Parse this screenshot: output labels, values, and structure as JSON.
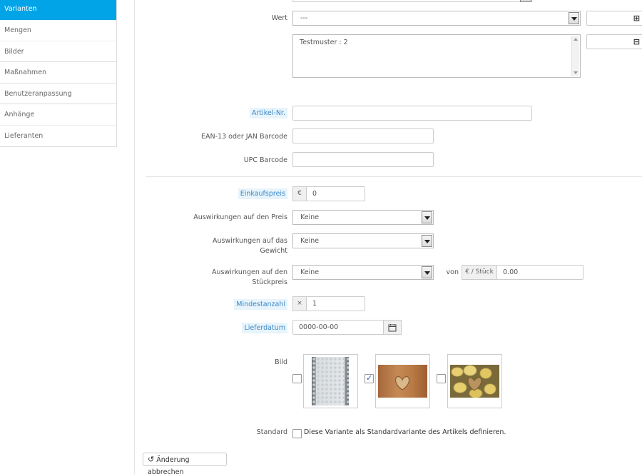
{
  "sidebar": {
    "items": [
      {
        "label": "Varianten",
        "active": true
      },
      {
        "label": "Mengen"
      },
      {
        "label": "Bilder"
      },
      {
        "label": "Maßnahmen"
      },
      {
        "label": "Benutzeranpassung"
      },
      {
        "label": "Anhänge"
      },
      {
        "label": "Lieferanten"
      }
    ]
  },
  "form": {
    "wert": {
      "label": "Wert",
      "value": "---"
    },
    "attributes_list": "Testmuster : 2",
    "artikel_nr": {
      "label": "Artikel-Nr.",
      "value": ""
    },
    "ean13": {
      "label": "EAN-13 oder JAN Barcode",
      "value": ""
    },
    "upc": {
      "label": "UPC Barcode",
      "value": ""
    },
    "einkaufspreis": {
      "label": "Einkaufspreis",
      "currency": "€",
      "value": "0"
    },
    "preis_impact": {
      "label": "Auswirkungen auf den Preis",
      "value": "Keine"
    },
    "gewicht_impact": {
      "label": "Auswirkungen auf das Gewicht",
      "value": "Keine"
    },
    "stueckpreis_impact": {
      "label": "Auswirkungen auf den Stückpreis",
      "value": "Keine",
      "von_label": "von",
      "unit": "€ / Stück",
      "amount": "0.00"
    },
    "mindestanzahl": {
      "label": "Mindestanzahl",
      "prefix": "×",
      "value": "1"
    },
    "lieferdatum": {
      "label": "Lieferdatum",
      "value": "0000-00-00"
    },
    "bild": {
      "label": "Bild",
      "images": [
        {
          "icon": "pattern-image",
          "checked": false
        },
        {
          "icon": "heart-image",
          "checked": true
        },
        {
          "icon": "potato-image",
          "checked": false
        }
      ]
    },
    "standard": {
      "label": "Standard",
      "text": "Diese Variante als Standardvariante des Artikels definieren.",
      "checked": false
    }
  },
  "buttons": {
    "cancel": "Änderung abbrechen",
    "add_icon": "plus-icon",
    "remove_icon": "minus-icon"
  },
  "colors": {
    "accent": "#00a4e7",
    "label_highlight": "#e7f4fc",
    "label_text": "#3b89c8"
  }
}
